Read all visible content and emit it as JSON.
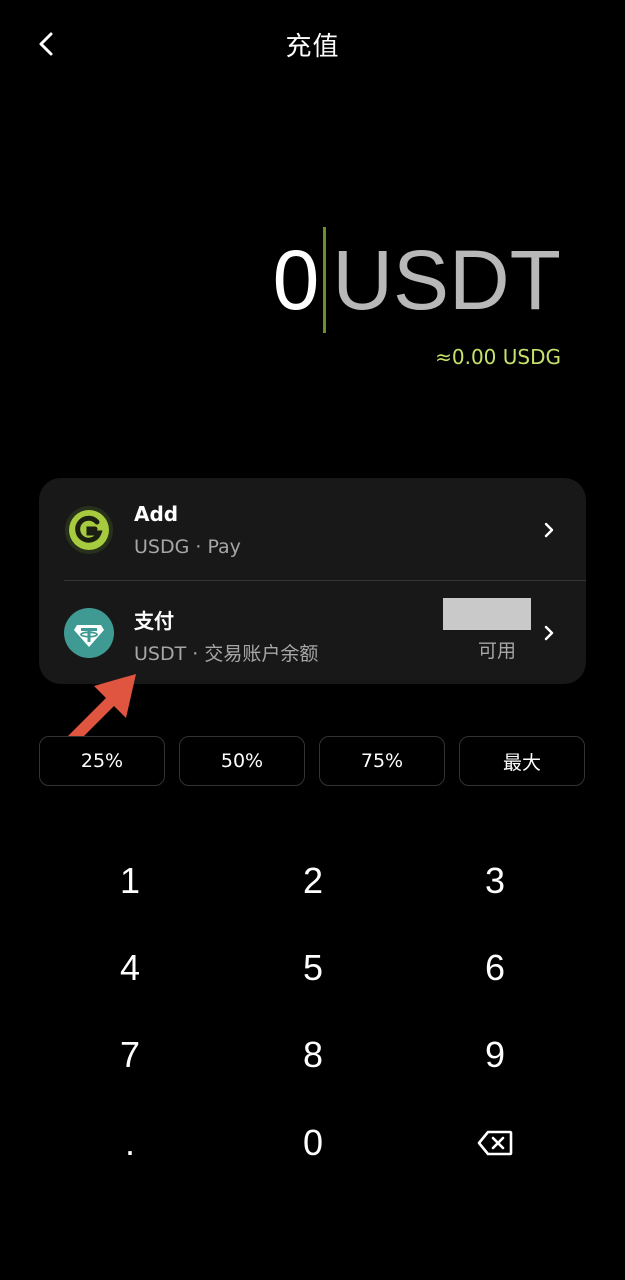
{
  "header": {
    "title": "充值",
    "back_icon": "chevron-left-icon"
  },
  "amount": {
    "value": "0",
    "unit": "USDT",
    "approx": "≈0.00 USDG",
    "caret_color": "#6b8f2a",
    "approx_color": "#c6e26a"
  },
  "methods": [
    {
      "title": "Add",
      "subtitle": "USDG · Pay",
      "icon": "usdg-logo-icon",
      "icon_color": "#a7cb3f"
    },
    {
      "title": "支付",
      "subtitle": "USDT · 交易账户余额",
      "available_label": "可用",
      "icon": "tether-logo-icon",
      "icon_color": "#3f9a93"
    }
  ],
  "percent_buttons": [
    "25%",
    "50%",
    "75%",
    "最大"
  ],
  "keypad": [
    "1",
    "2",
    "3",
    "4",
    "5",
    "6",
    "7",
    "8",
    "9",
    ".",
    "0"
  ]
}
